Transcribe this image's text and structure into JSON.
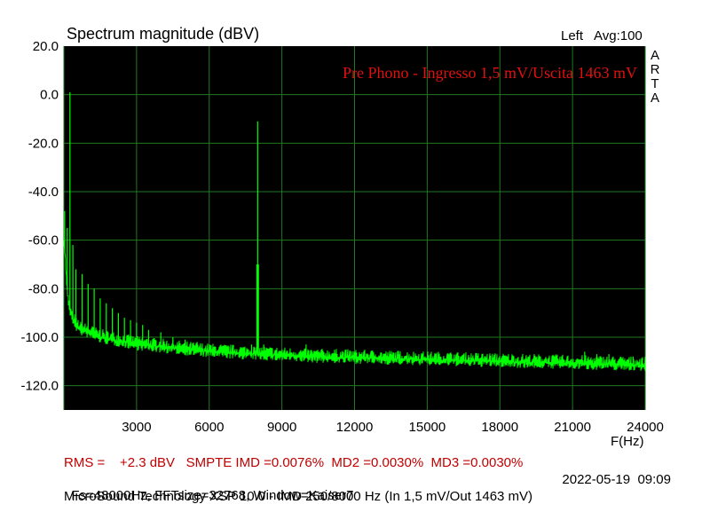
{
  "header": {
    "title": "Spectrum magnitude (dBV)",
    "channel": "Left",
    "averaging": "Avg:100",
    "brand_vertical": [
      "A",
      "R",
      "T",
      "A"
    ]
  },
  "annotation": "Pre Phono - Ingresso 1,5 mV/Uscita 1463 mV",
  "status": {
    "line1": "RMS =    +2.3 dBV   SMPTE IMD =0.0076%  MD2 =0.0030%  MD3 =0.0030%",
    "line2": "Fs=48000Hz, FFTsize=32768, Window=Kaiser7",
    "timestamp": "2022-05-19  09:09",
    "line3": "MicroSound Technology XSP 10.0 - IMD 250/8000 Hz (In 1,5 mV/Out 1463 mV)"
  },
  "colors": {
    "plot_background": "#000000",
    "grid": "#1f7a1f",
    "trace": "#00ff00",
    "annotation": "#e01010",
    "status_highlight": "#c00000"
  },
  "chart_data": {
    "type": "line",
    "title": "Spectrum magnitude (dBV)",
    "xlabel": "F(Hz)",
    "ylabel": "",
    "xlim": [
      0,
      24000
    ],
    "ylim": [
      -130,
      20
    ],
    "x_ticks": [
      3000,
      6000,
      9000,
      12000,
      15000,
      18000,
      21000,
      24000
    ],
    "x_tick_labels": [
      "3000",
      "6000",
      "9000",
      "12000",
      "15000",
      "18000",
      "21000",
      "24000"
    ],
    "y_ticks": [
      20,
      0,
      -20,
      -40,
      -60,
      -80,
      -100,
      -120
    ],
    "y_tick_labels": [
      "20.0",
      "0.0",
      "-20.0",
      "-40.0",
      "-60.0",
      "-80.0",
      "-100.0",
      "-120.0"
    ],
    "grid": true,
    "series": [
      {
        "floor": {
          "x": [
            0,
            50,
            100,
            150,
            200,
            300,
            400,
            500,
            700,
            1000,
            1500,
            2000,
            2500,
            3000,
            4000,
            5000,
            6000,
            7000,
            8000,
            10000,
            12000,
            14000,
            16000,
            18000,
            20000,
            22000,
            24000
          ],
          "y": [
            -60,
            -66,
            -75,
            -82,
            -87,
            -91,
            -93,
            -95,
            -97,
            -98,
            -100,
            -101,
            -102,
            -103,
            -104,
            -105,
            -106,
            -106.5,
            -107,
            -108,
            -108.5,
            -109,
            -109.5,
            -110,
            -110.5,
            -111,
            -111.5
          ]
        },
        "peaks": {
          "x": [
            30,
            140,
            250,
            370,
            500,
            750,
            1000,
            1250,
            1500,
            1750,
            2000,
            2250,
            2500,
            2750,
            3000,
            3250,
            3500,
            4000,
            4500,
            5000,
            5500,
            6000,
            7750,
            7970,
            8000,
            8030,
            8250,
            10000,
            16000,
            21500,
            22000,
            22500,
            23000,
            23500
          ],
          "y": [
            -48,
            -55,
            1,
            -62,
            -72,
            -74,
            -78,
            -80,
            -84,
            -86,
            -88,
            -90,
            -92,
            -93,
            -94,
            -95,
            -97,
            -98,
            -100,
            -101,
            -102,
            -103,
            -103,
            -70,
            -11,
            -70,
            -103,
            -103,
            -107,
            -106,
            -107,
            -107,
            -108,
            -108
          ]
        }
      }
    ]
  }
}
